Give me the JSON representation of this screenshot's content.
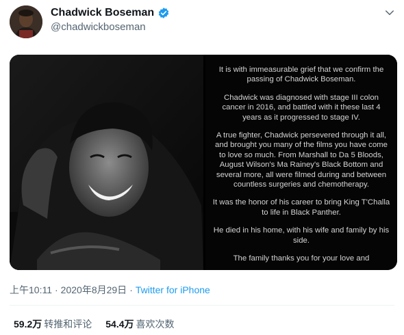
{
  "author": {
    "display_name": "Chadwick Boseman",
    "handle": "@chadwickboseman",
    "verified_color": "#1d9bf0",
    "avatar_icon": "profile-photo-icon"
  },
  "tweet": {
    "statement": [
      "It is with immeasurable grief that we confirm the passing of Chadwick Boseman.",
      "Chadwick was diagnosed with stage III colon cancer in 2016, and battled with it these last 4 years as it progressed to stage IV.",
      "A true fighter, Chadwick persevered through it all, and brought you many of the films you have come to love so much. From Marshall to Da 5 Bloods, August Wilson's Ma Rainey's Black Bottom and several more, all were filmed during and between countless surgeries and chemotherapy.",
      "It was the honor of his career to bring King T'Challa to life in Black Panther.",
      "He died in his home, with his wife and family by his side.",
      "The family thanks you for your love and"
    ],
    "time": "上午10:11",
    "date": "2020年8月29日",
    "source": "Twitter for iPhone",
    "separator": "·"
  },
  "stats": {
    "retweets_count": "59.2万",
    "retweets_label": "转推和评论",
    "likes_count": "54.4万",
    "likes_label": "喜欢次数"
  }
}
